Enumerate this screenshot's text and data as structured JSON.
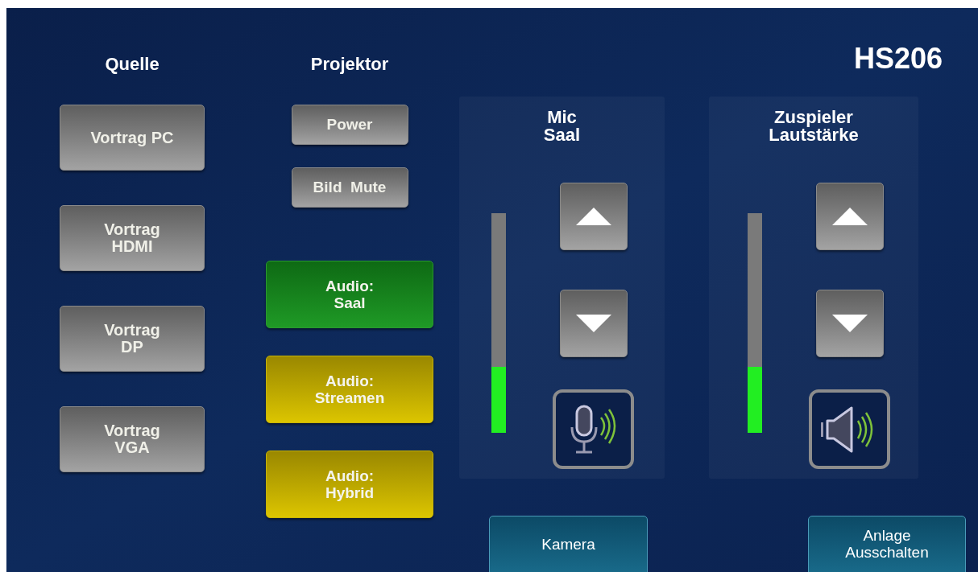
{
  "room": "HS206",
  "source": {
    "title": "Quelle",
    "buttons": [
      {
        "label": "Vortrag  PC"
      },
      {
        "label": "Vortrag\nHDMI"
      },
      {
        "label": "Vortrag\nDP"
      },
      {
        "label": "Vortrag\nVGA"
      }
    ]
  },
  "projector": {
    "title": "Projektor",
    "buttons": [
      {
        "label": "Power"
      },
      {
        "label": "Bild  Mute"
      }
    ],
    "audio_modes": [
      {
        "label": "Audio:\nSaal",
        "selected": true
      },
      {
        "label": "Audio:\nStreamen",
        "selected": false
      },
      {
        "label": "Audio:\nHybrid",
        "selected": false
      }
    ]
  },
  "volume_controls": [
    {
      "title": "Mic\nSaal",
      "kind": "mic",
      "level": 0.3,
      "bottom_button": "Kamera"
    },
    {
      "title": "Zuspieler\nLautstärke",
      "kind": "speaker",
      "level": 0.3,
      "bottom_button": "Anlage\nAusschalten"
    }
  ]
}
